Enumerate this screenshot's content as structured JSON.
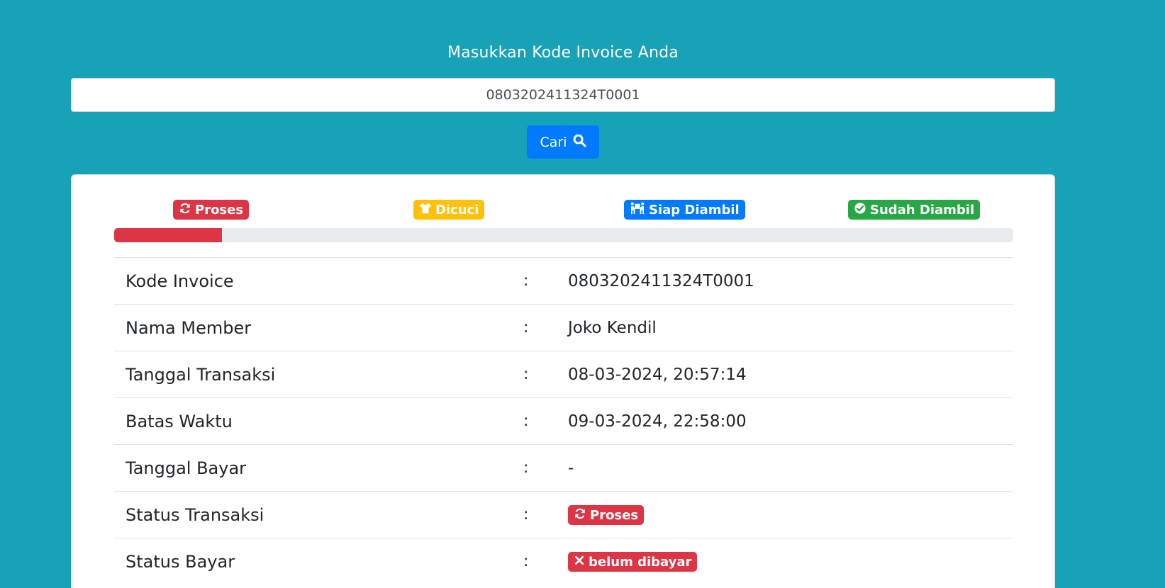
{
  "header": {
    "title": "Masukkan Kode Invoice Anda"
  },
  "search": {
    "value": "0803202411324T0001",
    "button_label": "Cari"
  },
  "colors": {
    "background": "#17a2b8",
    "primary": "#007bff",
    "danger": "#dc3545",
    "warning": "#ffc107",
    "success": "#28a745"
  },
  "steps": [
    {
      "label": "Proses",
      "icon": "sync-icon",
      "color": "#dc3545"
    },
    {
      "label": "Dicuci",
      "icon": "tshirt-icon",
      "color": "#ffc107"
    },
    {
      "label": "Siap Diambil",
      "icon": "people-carry-icon",
      "color": "#007bff"
    },
    {
      "label": "Sudah Diambil",
      "icon": "check-circle-icon",
      "color": "#28a745"
    }
  ],
  "progress": {
    "percent": 12
  },
  "details": {
    "separator": ":",
    "rows": [
      {
        "label": "Kode Invoice",
        "value": "0803202411324T0001"
      },
      {
        "label": "Nama Member",
        "value": "Joko Kendil"
      },
      {
        "label": "Tanggal Transaksi",
        "value": "08-03-2024, 20:57:14"
      },
      {
        "label": "Batas Waktu",
        "value": "09-03-2024, 22:58:00"
      },
      {
        "label": "Tanggal Bayar",
        "value": "-"
      },
      {
        "label": "Status Transaksi",
        "badge": "Proses",
        "icon": "sync-icon",
        "color": "#dc3545"
      },
      {
        "label": "Status Bayar",
        "badge": "belum dibayar",
        "icon": "times-icon",
        "color": "#dc3545"
      }
    ]
  }
}
